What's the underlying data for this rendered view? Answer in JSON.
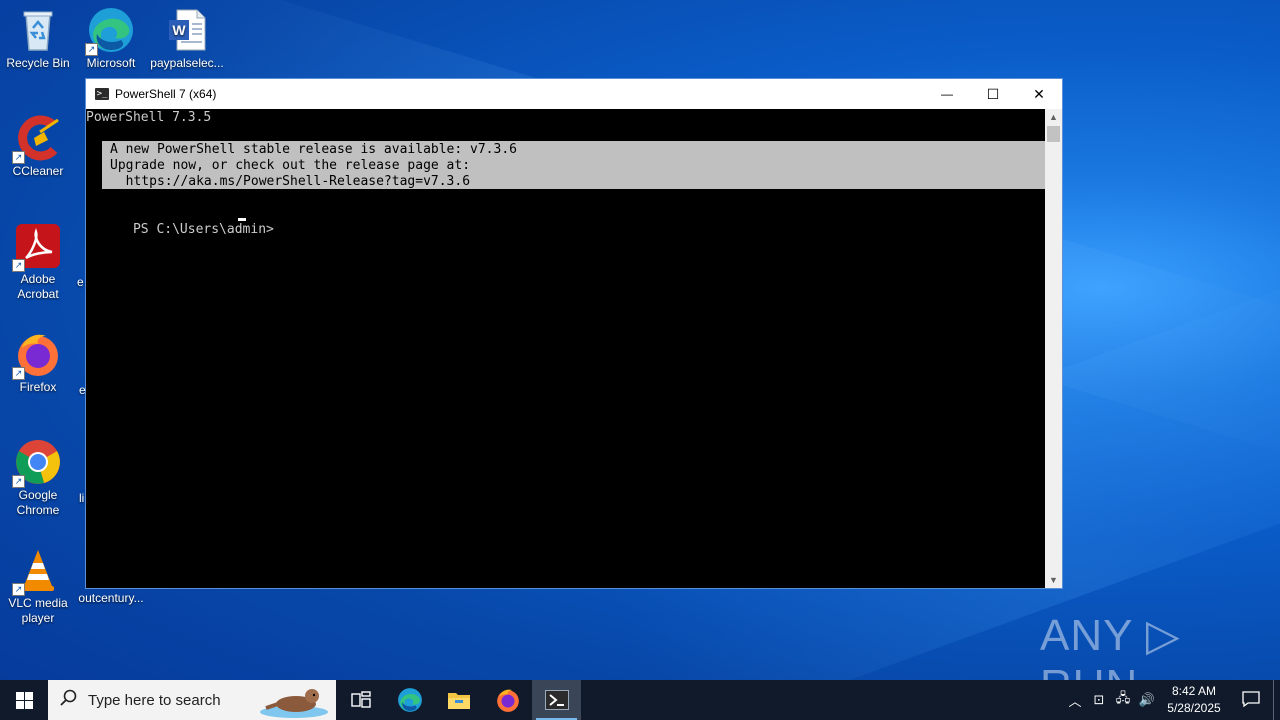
{
  "desktop": {
    "icons": [
      {
        "label": "Recycle Bin",
        "icon": "recycle-bin-icon"
      },
      {
        "label": "Microsoft Edge",
        "icon": "edge-icon"
      },
      {
        "label": "paypalselec...",
        "icon": "word-document-icon"
      },
      {
        "label": "CCleaner",
        "icon": "ccleaner-icon"
      },
      {
        "label": "Adobe Acrobat",
        "icon": "adobe-acrobat-icon"
      },
      {
        "label": "Firefox",
        "icon": "firefox-icon"
      },
      {
        "label": "Google Chrome",
        "icon": "chrome-icon"
      },
      {
        "label": "VLC media player",
        "icon": "vlc-icon"
      },
      {
        "label": "outcentury...",
        "icon": "file-icon"
      }
    ],
    "partial_labels": [
      "e",
      "e",
      "li"
    ]
  },
  "window": {
    "title": "PowerShell 7 (x64)",
    "controls": {
      "minimize": "—",
      "maximize": "☐",
      "close": "✕"
    },
    "console": {
      "version_line": "PowerShell 7.3.5",
      "banner": [
        "A new PowerShell stable release is available: v7.3.6",
        "Upgrade now, or check out the release page at:",
        "  https://aka.ms/PowerShell-Release?tag=v7.3.6"
      ],
      "prompt": "PS C:\\Users\\admin> "
    }
  },
  "watermark": "ANY ▷ RUN",
  "taskbar": {
    "search_placeholder": "Type here to search",
    "pinned": [
      "task-view-icon",
      "edge-icon",
      "file-explorer-icon",
      "firefox-icon",
      "powershell-icon"
    ],
    "active": "powershell-icon",
    "clock": {
      "time": "8:42 AM",
      "date": "5/28/2025"
    }
  },
  "colors": {
    "console_bg": "#000000",
    "banner_bg": "#c0c0c0",
    "taskbar_bg": "#101a2a",
    "desktop_accent": "#0a5cc8"
  }
}
